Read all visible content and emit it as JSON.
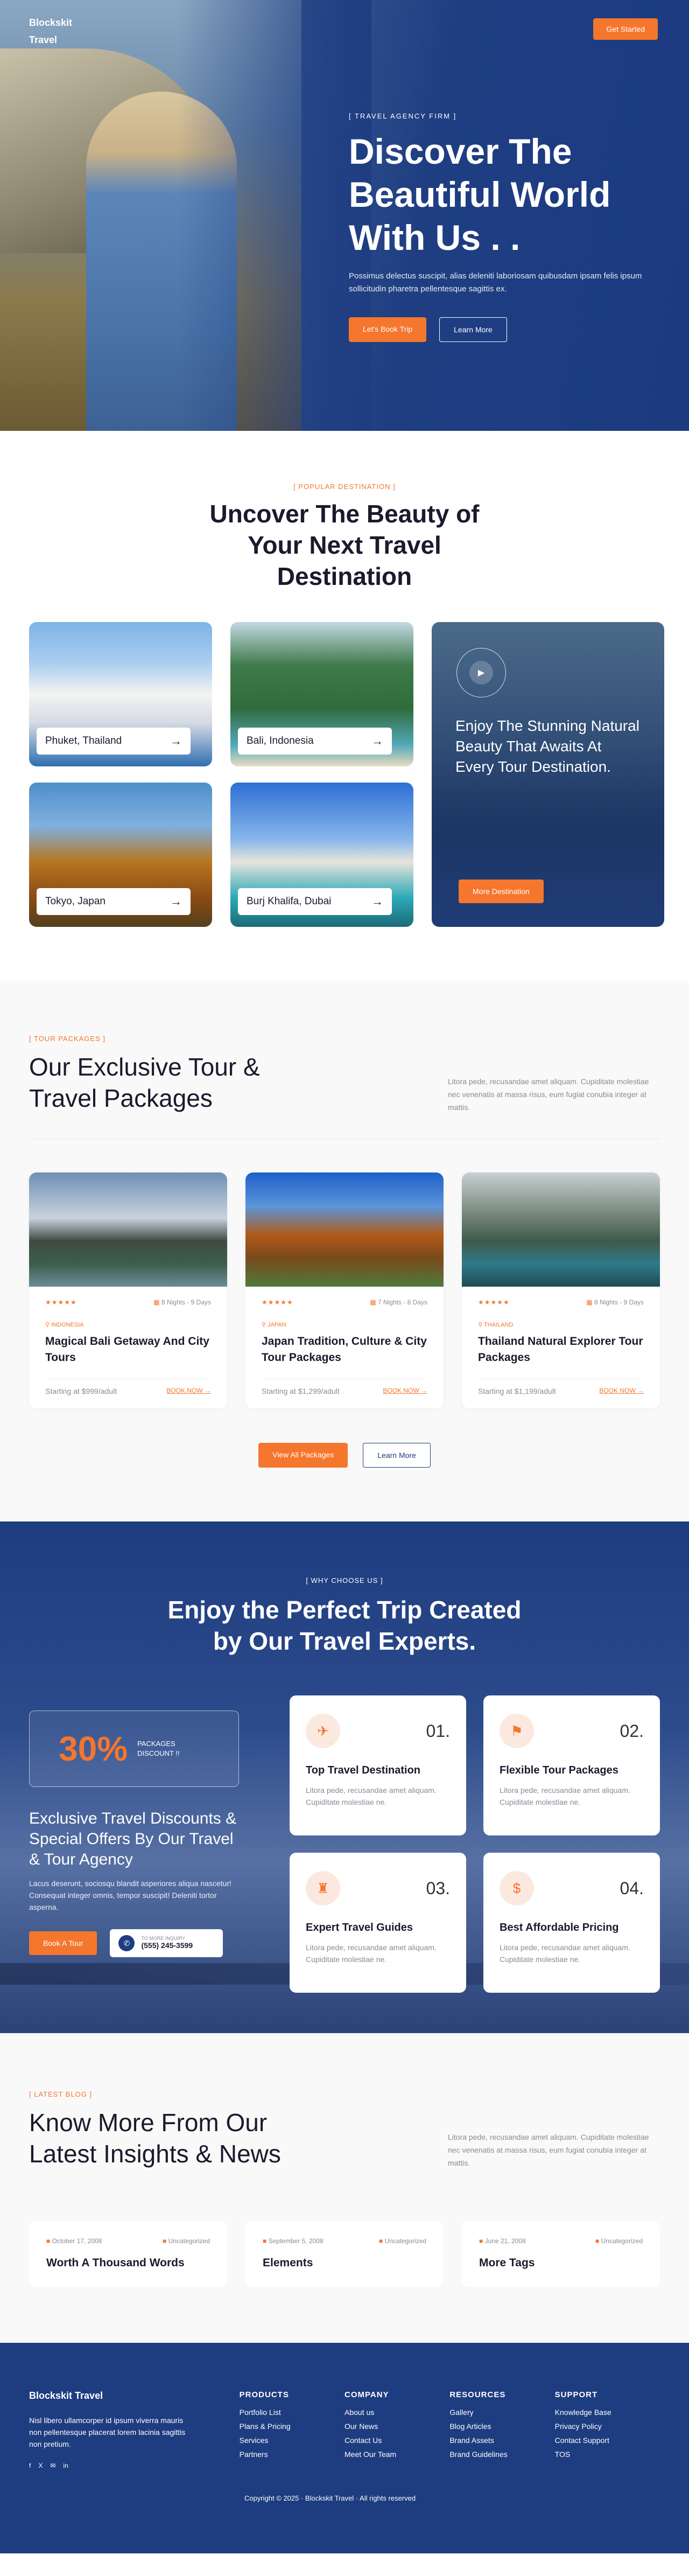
{
  "nav": {
    "logo": "Blockskit\nTravel",
    "cta": "Get Started"
  },
  "hero": {
    "eyebrow": "[ TRAVEL AGENCY FIRM ]",
    "title": "Discover The Beautiful World With Us . .",
    "desc": "Possimus delectus suscipit, alias deleniti laboriosam quibusdam ipsam felis ipsum sollicitudin pharetra pellentesque sagittis ex.",
    "btn_primary": "Let's Book Trip",
    "btn_secondary": "Learn More"
  },
  "destinations": {
    "tag": "[ POPULAR DESTINATION ]",
    "title": "Uncover The Beauty of Your Next Travel Destination",
    "items": [
      {
        "name": "Phuket, Thailand"
      },
      {
        "name": "Bali, Indonesia"
      },
      {
        "name": "Tokyo, Japan"
      },
      {
        "name": "Burj Khalifa, Dubai"
      }
    ],
    "feature": {
      "title": "Enjoy The Stunning Natural Beauty That Awaits At Every Tour Destination.",
      "button": "More Destination"
    }
  },
  "tours": {
    "tag": "[ TOUR PACKAGES ]",
    "title": "Our Exclusive Tour & Travel Packages",
    "desc": "Litora pede, recusandae amet aliquam. Cupiditate molestiae nec venenatis at massa risus, eum fugiat conubia integer at mattis.",
    "items": [
      {
        "stars": "★★★★★",
        "duration": "8 Nights - 9 Days",
        "location": "INDONESIA",
        "title": "Magical Bali Getaway And City Tours",
        "price": "Starting at $999/adult",
        "cta": "BOOK NOW →"
      },
      {
        "stars": "★★★★★",
        "duration": "7 Nights - 8 Days",
        "location": "JAPAN",
        "title": "Japan Tradition, Culture & City Tour Packages",
        "price": "Starting at $1,299/adult",
        "cta": "BOOK NOW →"
      },
      {
        "stars": "★★★★★",
        "duration": "8 Nights - 9 Days",
        "location": "THAILAND",
        "title": "Thailand Natural Explorer Tour Packages",
        "price": "Starting at $1,199/adult",
        "cta": "BOOK NOW →"
      }
    ],
    "btn_all": "View All Packages",
    "btn_more": "Learn More"
  },
  "why": {
    "tag": "[ WHY CHOOSE US ]",
    "title": "Enjoy the Perfect Trip Created by Our Travel Experts.",
    "promo_pct": "30%",
    "promo_label": "PACKAGES DISCOUNT !!",
    "heading": "Exclusive Travel Discounts & Special Offers By Our Travel & Tour Agency",
    "desc": "Lacus deserunt, sociosqu blandit asperiores aliqua nascetur! Consequat integer omnis, tempor suscipit! Deleniti tortor aspernа.",
    "btn": "Book A Tour",
    "phone_label": "TO MORE INQUIRY",
    "phone": "(555) 245-3599",
    "cards": [
      {
        "num": "01.",
        "title": "Top Travel Destination",
        "desc": "Litora pede, recusandae amet aliquam. Cupiditate molestiae ne."
      },
      {
        "num": "02.",
        "title": "Flexible Tour Packages",
        "desc": "Litora pede, recusandae amet aliquam. Cupiditate molestiae ne."
      },
      {
        "num": "03.",
        "title": "Expert Travel Guides",
        "desc": "Litora pede, recusandae amet aliquam. Cupiditate molestiae ne."
      },
      {
        "num": "04.",
        "title": "Best Affordable Pricing",
        "desc": "Litora pede, recusandae amet aliquam. Cupiditate molestiae ne."
      }
    ]
  },
  "blog": {
    "tag": "[ LATEST BLOG ]",
    "title": "Know More From Our Latest Insights & News",
    "desc": "Litora pede, recusandae amet aliquam. Cupiditate molestiae nec venenatis at massa risus, eum fugiat conubia integer at mattis.",
    "posts": [
      {
        "date": "October 17, 2008",
        "category": "Uncategorized",
        "title": "Worth A Thousand Words"
      },
      {
        "date": "September 5, 2008",
        "category": "Uncategorized",
        "title": "Elements"
      },
      {
        "date": "June 21, 2008",
        "category": "Uncategorized",
        "title": "More Tags"
      }
    ]
  },
  "footer": {
    "brand": "Blockskit Travel",
    "desc": "Nisl libero ullamcorper id ipsum viverra mauris non pellentesque placerat lorem lacinia sagittis non pretium.",
    "social": [
      "f",
      "X",
      "✉",
      "in"
    ],
    "cols": [
      {
        "title": "PRODUCTS",
        "links": [
          "Portfolio List",
          "Plans & Pricing",
          "Services",
          "Partners"
        ]
      },
      {
        "title": "COMPANY",
        "links": [
          "About us",
          "Our News",
          "Contact Us",
          "Meet Our Team"
        ]
      },
      {
        "title": "RESOURCES",
        "links": [
          "Gallery",
          "Blog Articles",
          "Brand Assets",
          "Brand Guidelines"
        ]
      },
      {
        "title": "SUPPORT",
        "links": [
          "Knowledge Base",
          "Privacy Policy",
          "Contact Support",
          "TOS"
        ]
      }
    ],
    "copyright": "Copyright © 2025 · Blockskit Travel · All rights reserved"
  }
}
